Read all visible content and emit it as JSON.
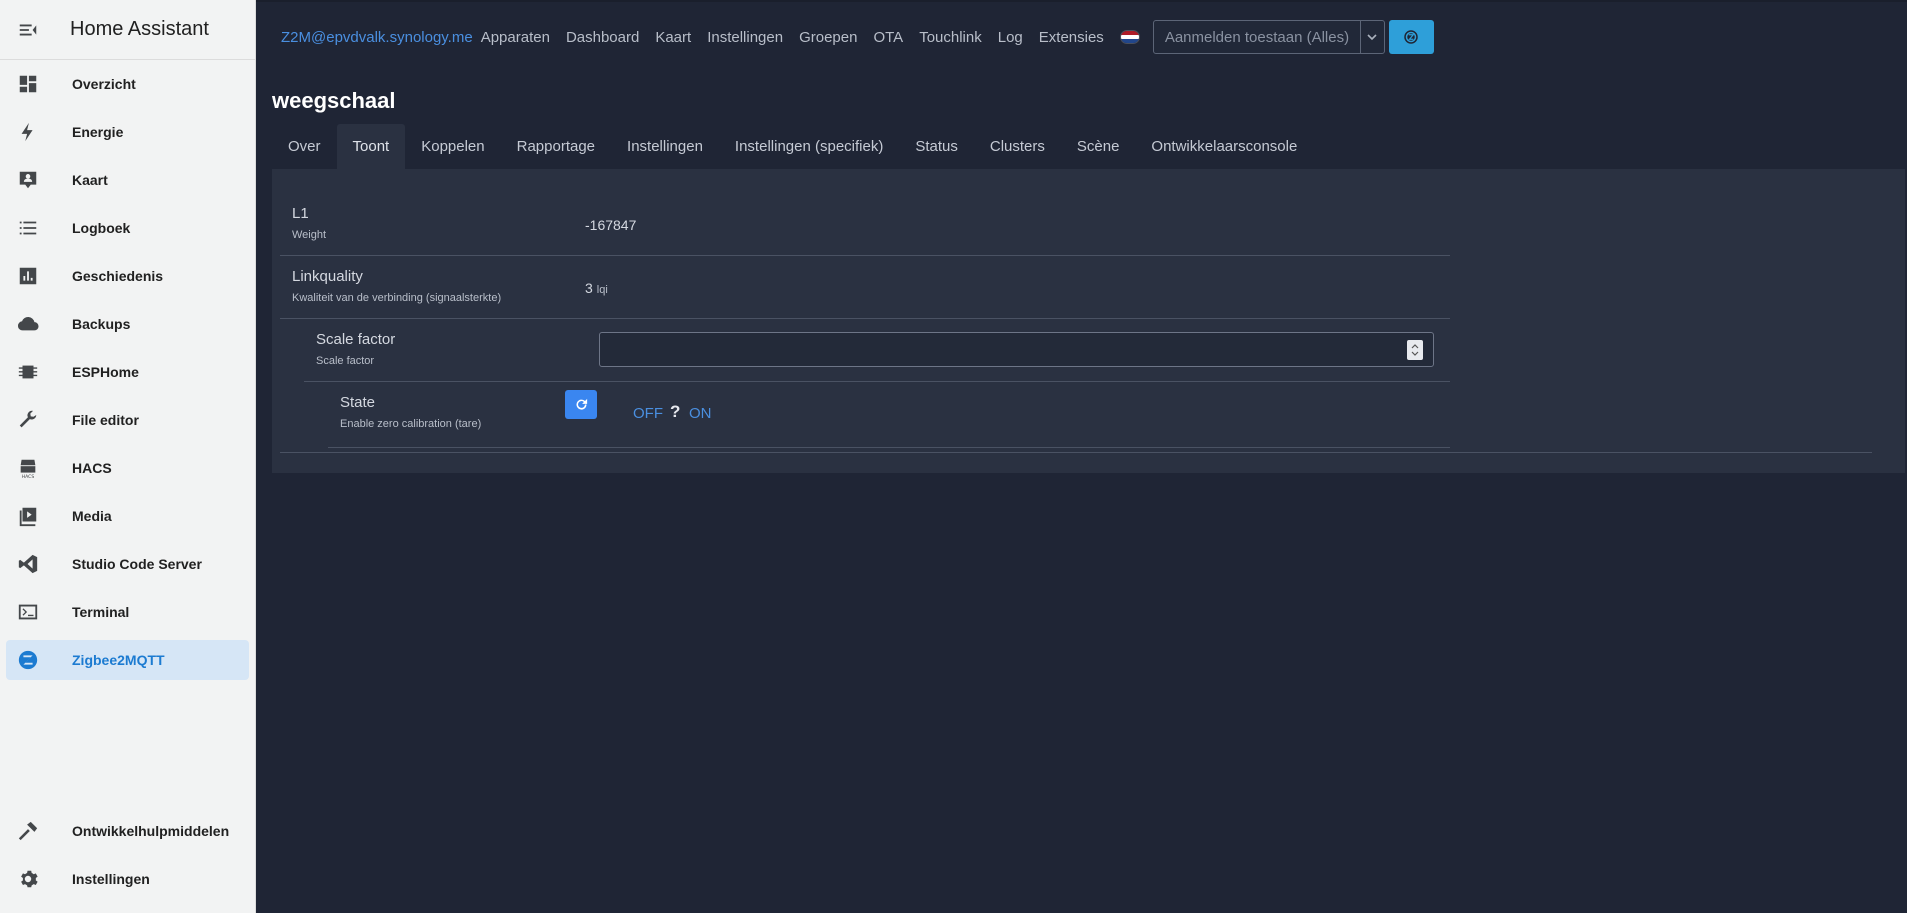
{
  "sidebar": {
    "title": "Home Assistant",
    "items": [
      {
        "label": "Overzicht",
        "icon": "dashboard-icon"
      },
      {
        "label": "Energie",
        "icon": "lightning-icon"
      },
      {
        "label": "Kaart",
        "icon": "map-icon"
      },
      {
        "label": "Logboek",
        "icon": "list-icon"
      },
      {
        "label": "Geschiedenis",
        "icon": "chart-icon"
      },
      {
        "label": "Backups",
        "icon": "cloud-icon"
      },
      {
        "label": "ESPHome",
        "icon": "chip-icon"
      },
      {
        "label": "File editor",
        "icon": "wrench-icon"
      },
      {
        "label": "HACS",
        "icon": "hacs-icon"
      },
      {
        "label": "Media",
        "icon": "media-icon"
      },
      {
        "label": "Studio Code Server",
        "icon": "vscode-icon"
      },
      {
        "label": "Terminal",
        "icon": "terminal-icon"
      },
      {
        "label": "Zigbee2MQTT",
        "icon": "zigbee-icon"
      }
    ],
    "bottom": [
      {
        "label": "Ontwikkelhulpmiddelen",
        "icon": "hammer-icon"
      },
      {
        "label": "Instellingen",
        "icon": "cog-icon"
      }
    ],
    "active_index": 12
  },
  "topnav": {
    "brand": "Z2M@epvdvalk.synology.me",
    "links": [
      "Apparaten",
      "Dashboard",
      "Kaart",
      "Instellingen",
      "Groepen",
      "OTA",
      "Touchlink",
      "Log",
      "Extensies"
    ],
    "permit_join": "Aanmelden toestaan (Alles)",
    "flag_colors": [
      "#ae1c28",
      "#ffffff",
      "#21468b"
    ],
    "accent": "#2e9fd9"
  },
  "device": {
    "title": "weegschaal",
    "tabs": [
      "Over",
      "Toont",
      "Koppelen",
      "Rapportage",
      "Instellingen",
      "Instellingen (specifiek)",
      "Status",
      "Clusters",
      "Scène",
      "Ontwikkelaarsconsole"
    ],
    "active_tab": 1
  },
  "exposes": {
    "l1": {
      "label": "L1",
      "sub": "Weight",
      "value": "-167847"
    },
    "linkquality": {
      "label": "Linkquality",
      "sub": "Kwaliteit van de verbinding (signaalsterkte)",
      "value": "3",
      "unit": "lqi"
    },
    "scale_factor": {
      "label": "Scale factor",
      "sub": "Scale factor",
      "value": ""
    },
    "state": {
      "label": "State",
      "sub": "Enable zero calibration (tare)",
      "off": "OFF",
      "unknown": "?",
      "on": "ON"
    }
  }
}
